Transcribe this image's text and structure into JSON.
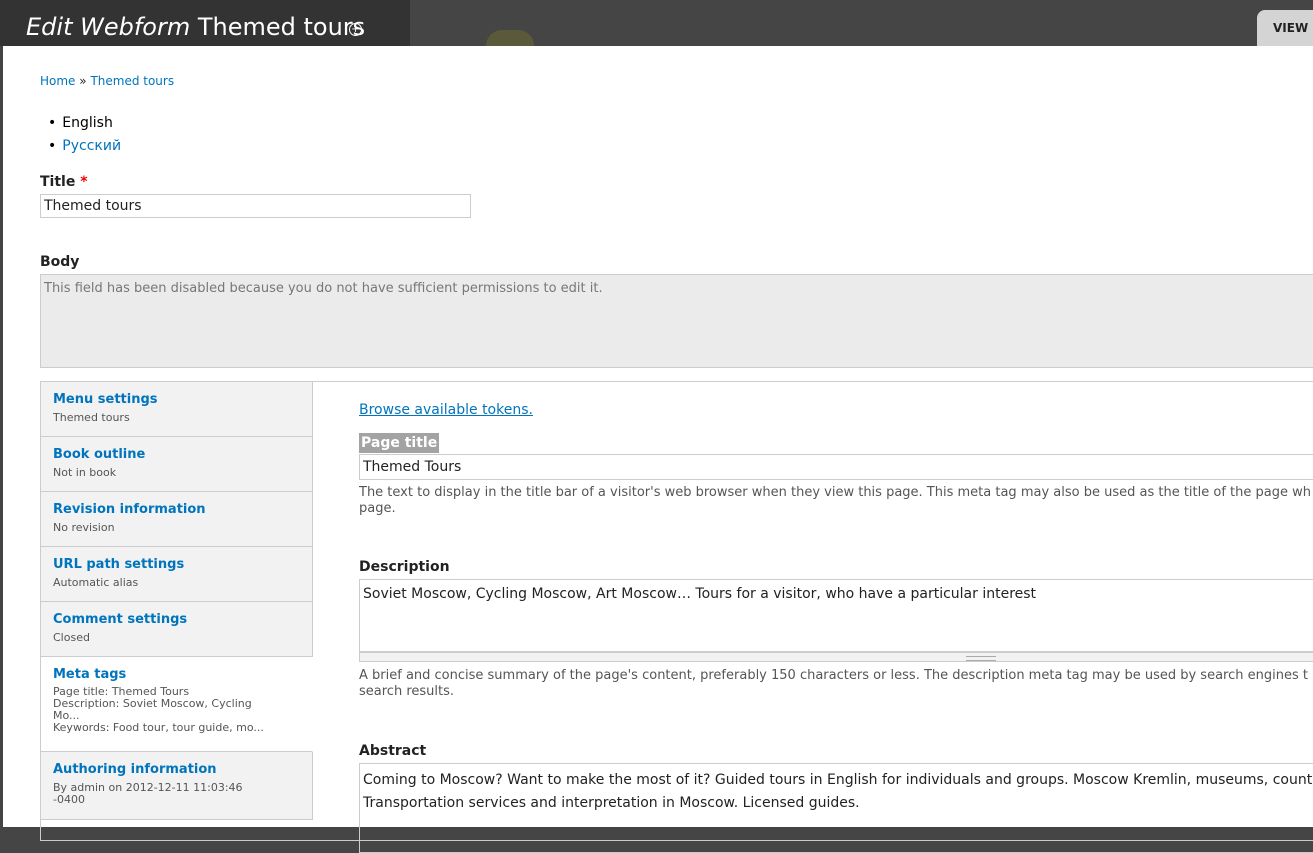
{
  "header": {
    "title_em": "Edit Webform",
    "title_rest": "Themed tours",
    "shortcut_icon": "plus-circle-icon",
    "view_tab": "VIEW"
  },
  "breadcrumb": {
    "home": "Home",
    "separator": "»",
    "current": "Themed tours"
  },
  "languages": {
    "english": "English",
    "russian": "Русский"
  },
  "form": {
    "title_label": "Title",
    "required_mark": "*",
    "title_value": "Themed tours",
    "body_label": "Body",
    "body_disabled_text": "This field has been disabled because you do not have sufficient permissions to edit it."
  },
  "vertical_tabs": [
    {
      "title": "Menu settings",
      "summary": "Themed tours"
    },
    {
      "title": "Book outline",
      "summary": "Not in book"
    },
    {
      "title": "Revision information",
      "summary": "No revision"
    },
    {
      "title": "URL path settings",
      "summary": "Automatic alias"
    },
    {
      "title": "Comment settings",
      "summary": "Closed"
    },
    {
      "title": "Meta tags",
      "summary_1": "Page title: Themed Tours",
      "summary_2": "Description: Soviet Moscow, Cycling",
      "summary_3": "Mo...",
      "summary_4": "Keywords: Food tour, tour guide, mo..."
    },
    {
      "title": "Authoring information",
      "summary_1": "By admin on 2012-12-11 11:03:46",
      "summary_2": "-0400"
    }
  ],
  "meta_pane": {
    "tokens_link": "Browse available tokens.",
    "page_title_label": "Page title",
    "page_title_value": "Themed Tours",
    "page_title_desc_1": "The text to display in the title bar of a visitor's web browser when they view this page. This meta tag may also be used as the title of the page wh",
    "page_title_desc_2": "page.",
    "description_label": "Description",
    "description_value": "Soviet Moscow, Cycling Moscow, Art Moscow… Tours for a visitor, who have a particular interest",
    "description_desc_1": "A brief and concise summary of the page's content, preferably 150 characters or less. The description meta tag may be used by search engines t",
    "description_desc_2": "search results.",
    "abstract_label": "Abstract",
    "abstract_line_1": "Coming to Moscow? Want to make the most of it? Guided tours in English for individuals and groups. Moscow Kremlin, museums, country-side tour",
    "abstract_line_2": "Transportation services and interpretation in Moscow. Licensed guides."
  }
}
